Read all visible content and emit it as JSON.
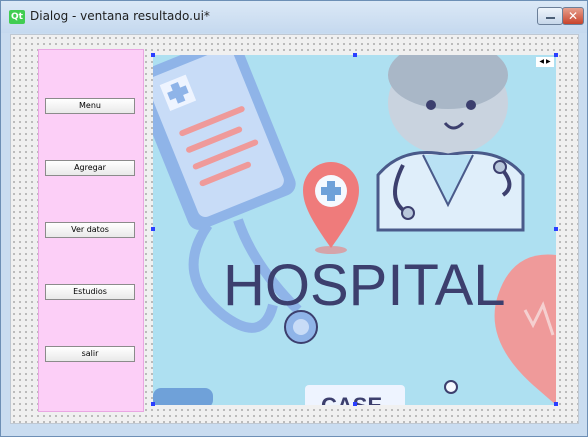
{
  "window": {
    "title": "Dialog - ventana resultado.ui*",
    "app_icon": "qt-icon"
  },
  "sidebar": {
    "buttons": [
      {
        "label": "Menu"
      },
      {
        "label": "Agregar"
      },
      {
        "label": "Ver datos"
      },
      {
        "label": "Estudios"
      },
      {
        "label": "salir"
      }
    ]
  },
  "image": {
    "text": "HOSPITAL",
    "badge_text": "CASE"
  },
  "colors": {
    "sidebar": "#fccff7",
    "image_bg": "#aee0f1",
    "hospital_text": "#3c3f6e"
  }
}
